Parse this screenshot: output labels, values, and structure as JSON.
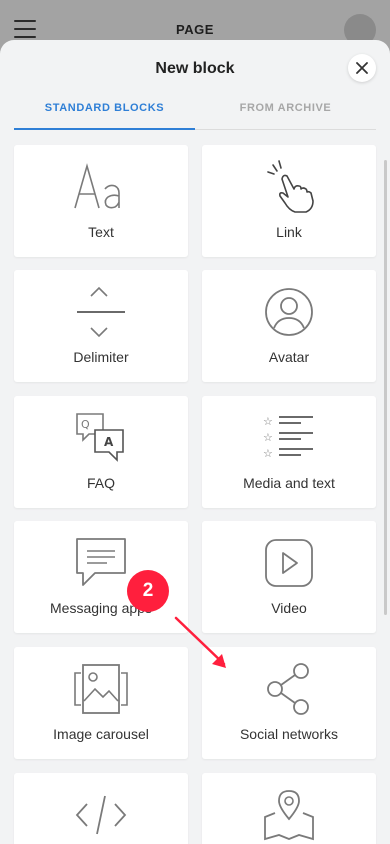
{
  "app": {
    "header_title": "PAGE"
  },
  "sheet": {
    "title": "New block",
    "tabs": [
      {
        "label": "STANDARD BLOCKS",
        "active": true
      },
      {
        "label": "FROM ARCHIVE",
        "active": false
      }
    ]
  },
  "blocks": [
    {
      "label": "Text",
      "icon": "text-icon"
    },
    {
      "label": "Link",
      "icon": "hand-pointer-icon"
    },
    {
      "label": "Delimiter",
      "icon": "delimiter-icon"
    },
    {
      "label": "Avatar",
      "icon": "avatar-icon"
    },
    {
      "label": "FAQ",
      "icon": "faq-icon"
    },
    {
      "label": "Media and text",
      "icon": "media-text-icon"
    },
    {
      "label": "Messaging apps",
      "icon": "chat-icon"
    },
    {
      "label": "Video",
      "icon": "play-icon"
    },
    {
      "label": "Image carousel",
      "icon": "image-carousel-icon"
    },
    {
      "label": "Social networks",
      "icon": "share-icon"
    },
    {
      "label": "",
      "icon": "code-icon"
    },
    {
      "label": "",
      "icon": "map-pin-icon"
    }
  ],
  "annotation": {
    "step": "2",
    "color": "#ff1f3d"
  },
  "colors": {
    "accent": "#2f7fd6",
    "icon": "#7a7a7a"
  }
}
